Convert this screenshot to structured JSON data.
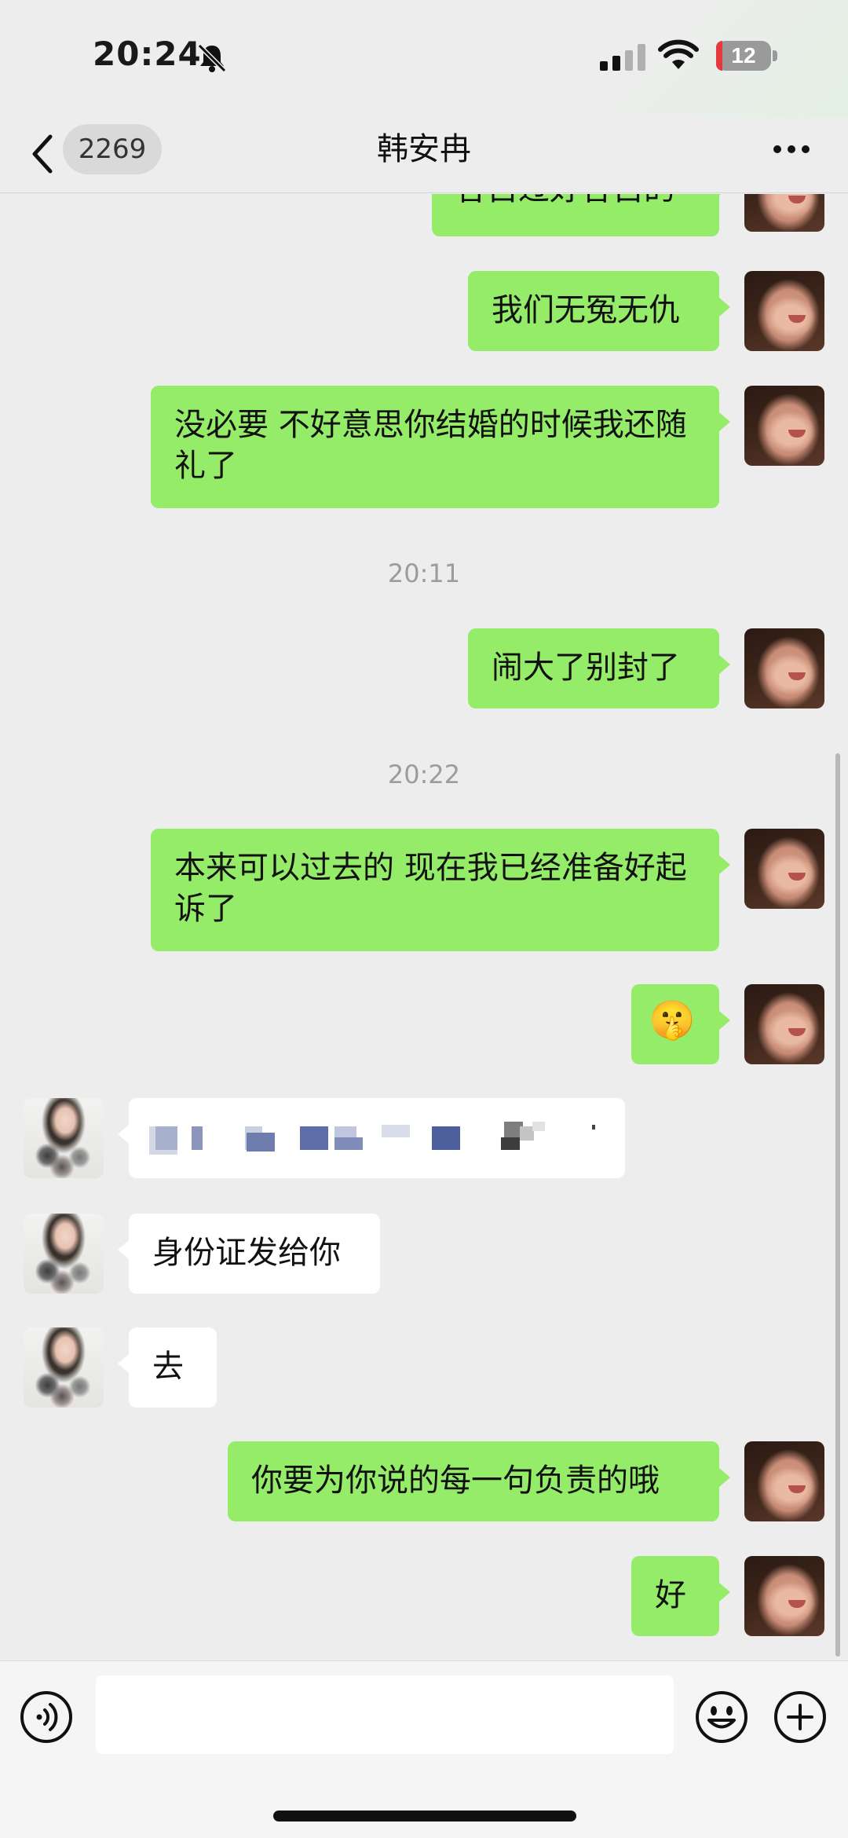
{
  "status_bar": {
    "time": "20:24",
    "battery": "12"
  },
  "nav": {
    "unread_count": "2269",
    "title": "韩安冉"
  },
  "messages": [
    {
      "side": "me",
      "text": "各自过好各自的"
    },
    {
      "side": "me",
      "text": "我们无冤无仇"
    },
    {
      "side": "me",
      "text": "没必要 不好意思你结婚的时候我还随礼了"
    },
    {
      "type": "time",
      "text": "20:11"
    },
    {
      "side": "me",
      "text": "闹大了别封了"
    },
    {
      "type": "time",
      "text": "20:22"
    },
    {
      "side": "me",
      "text": "本来可以过去的 现在我已经准备好起诉了"
    },
    {
      "side": "me",
      "text": "🤫"
    },
    {
      "side": "her",
      "text": "",
      "pixelated": true
    },
    {
      "side": "her",
      "text": "身份证发给你"
    },
    {
      "side": "her",
      "text": "去"
    },
    {
      "side": "me",
      "text": "你要为你说的每一句负责的哦"
    },
    {
      "side": "me",
      "text": "好"
    }
  ],
  "input_bar": {
    "icons": [
      "voice-icon",
      "emoji-icon",
      "plus-icon"
    ]
  },
  "colors": {
    "my_bubble": "#95ec69",
    "her_bubble": "#ffffff",
    "background": "#ededed"
  }
}
